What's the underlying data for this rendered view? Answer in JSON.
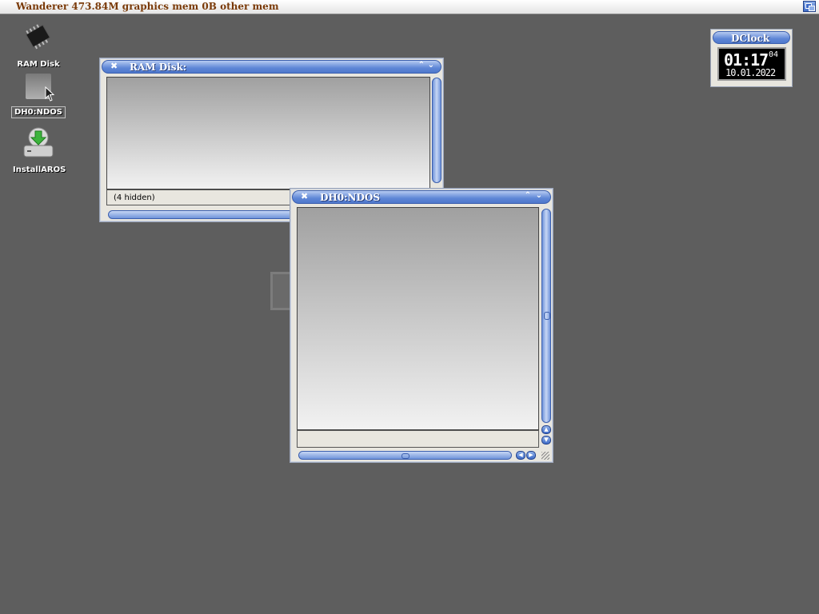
{
  "screenbar": {
    "title": "Wanderer 473.84M graphics mem 0B other mem"
  },
  "desktop_icons": [
    {
      "label": "RAM Disk",
      "icon": "chip-icon"
    },
    {
      "label": "DH0:NDOS",
      "icon": "drive-icon"
    },
    {
      "label": "InstallAROS",
      "icon": "install-icon"
    }
  ],
  "windows": {
    "ramdisk": {
      "title": "RAM Disk:",
      "status": "(4 hidden)"
    },
    "dh0": {
      "title": "DH0:NDOS",
      "status": ""
    }
  },
  "dclock": {
    "title": "DClock",
    "time": "01:17",
    "seconds": "04",
    "date": "10.01.2022"
  },
  "colors": {
    "desktop": "#5e5e5e",
    "titlebar_accent": "#5e86d6",
    "screenbar_text": "#7a3a08"
  }
}
